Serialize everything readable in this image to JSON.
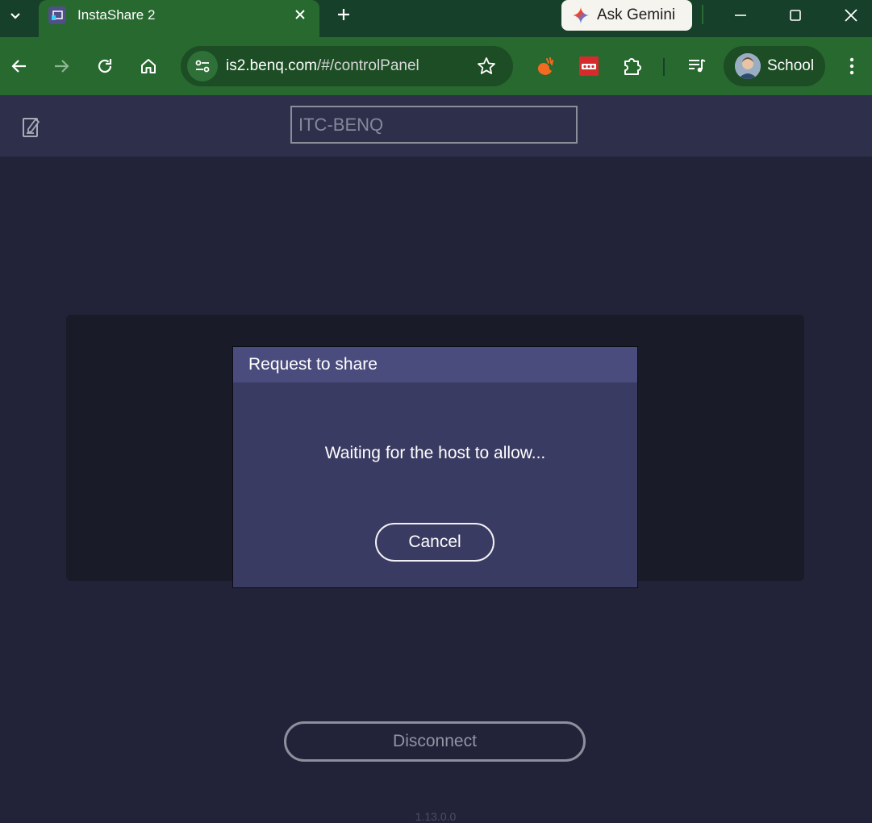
{
  "browser": {
    "tab": {
      "title": "InstaShare 2"
    },
    "gemini": {
      "label": "Ask Gemini"
    },
    "address_bar": {
      "host": "is2.benq.com",
      "path": "/#/controlPanel"
    },
    "profile": {
      "label": "School"
    },
    "icons": [
      "tab-search-icon",
      "instashare-favicon",
      "close-icon",
      "new-tab-icon",
      "gemini-icon",
      "minimize-icon",
      "maximize-icon",
      "close-window-icon",
      "back-icon",
      "forward-icon",
      "reload-icon",
      "home-icon",
      "site-info-icon",
      "bookmark-star-icon",
      "extension-orange-icon",
      "extension-red-icon",
      "extensions-puzzle-icon",
      "media-controls-icon",
      "avatar",
      "more-menu-icon"
    ]
  },
  "app": {
    "room_name": "ITC-BENQ",
    "disconnect_label": "Disconnect",
    "version": "1.13.0.0"
  },
  "dialog": {
    "title": "Request to share",
    "message": "Waiting for the host to allow...",
    "cancel_label": "Cancel"
  },
  "colors": {
    "browser_frame": "#16402a",
    "browser_toolbar": "#28692f",
    "app_background": "#222339",
    "app_header": "#2e2f4b",
    "dialog_body": "#3a3b62",
    "dialog_header": "#4a4c7e"
  }
}
